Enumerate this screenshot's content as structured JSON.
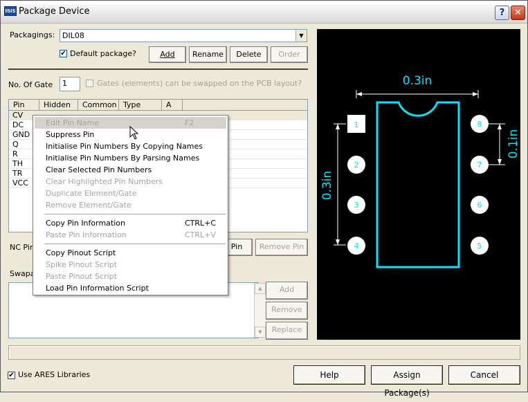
{
  "window": {
    "title": "Package Device",
    "app_icon_text": "ISIS"
  },
  "packagings": {
    "label": "Packagings:",
    "value": "DIL08",
    "default_package": {
      "label": "Default package?",
      "checked": true
    }
  },
  "pkg_buttons": {
    "add": "Add",
    "rename": "Rename",
    "delete": "Delete",
    "order": "Order"
  },
  "gates": {
    "label": "No. Of Gate",
    "value": "1",
    "swap_label": "Gates (elements) can be swapped on the PCB layout?"
  },
  "pin_table": {
    "columns": [
      "Pin",
      "Hidden",
      "Common",
      "Type",
      "A"
    ],
    "rows": [
      "CV",
      "DC",
      "GND",
      "Q",
      "R",
      "TH",
      "TR",
      "VCC"
    ]
  },
  "nc_pins": {
    "label": "NC Pin",
    "add_pin": "Pin",
    "remove_pin": "Remove Pin"
  },
  "swap": {
    "label": "Swapa",
    "add": "Add",
    "remove": "Remove",
    "replace": "Replace"
  },
  "bottom": {
    "use_ares": {
      "label": "Use ARES Libraries",
      "checked": true
    },
    "help": "Help",
    "assign": "Assign Package(s)",
    "cancel": "Cancel"
  },
  "context_menu": {
    "items": [
      {
        "label": "Edit Pin Name",
        "shortcut": "F2",
        "enabled": false,
        "highlighted": true
      },
      {
        "label": "Suppress Pin",
        "enabled": true
      },
      {
        "label": "Initialise Pin Numbers By Copying Names",
        "enabled": true
      },
      {
        "label": "Initialise Pin Numbers By Parsing Names",
        "enabled": true
      },
      {
        "label": "Clear Selected Pin Numbers",
        "enabled": true
      },
      {
        "label": "Clear Highlighted Pin Numbers",
        "enabled": false
      },
      {
        "label": "Duplicate Element/Gate",
        "enabled": false
      },
      {
        "label": "Remove Element/Gate",
        "enabled": false
      },
      {
        "label": "Copy Pin Information",
        "shortcut": "CTRL+C",
        "enabled": true
      },
      {
        "label": "Paste Pin Information",
        "shortcut": "CTRL+V",
        "enabled": false
      },
      {
        "label": "Copy Pinout Script",
        "enabled": true
      },
      {
        "label": "Spike Pinout Script",
        "enabled": false
      },
      {
        "label": "Paste Pinout Script",
        "enabled": false
      },
      {
        "label": "Load Pin Information Script",
        "enabled": true
      }
    ]
  },
  "preview": {
    "width_dim": "0.3in",
    "height_dim": "0.3in",
    "pitch_dim": "0.1in",
    "pins_left": [
      "1",
      "2",
      "3",
      "4"
    ],
    "pins_right": [
      "8",
      "7",
      "6",
      "5"
    ],
    "colors": {
      "outline": "#00e5ff",
      "pad": "#ffffff",
      "dims": "#ffffff",
      "background": "#000000"
    }
  }
}
